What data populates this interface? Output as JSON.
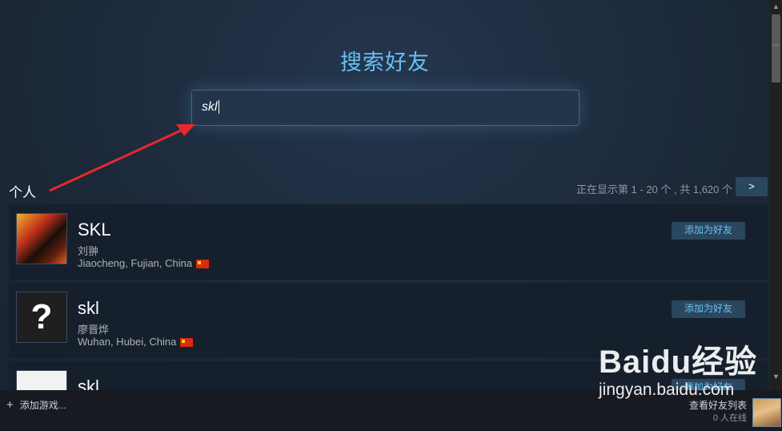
{
  "header": {
    "title": "搜索好友"
  },
  "search": {
    "value": "skl"
  },
  "results": {
    "section_label": "个人",
    "count_text": "正在显示第 1 - 20 个 , 共 1,620 个",
    "next_label": ">",
    "users": [
      {
        "name": "SKL",
        "alias": "刘翀",
        "location": "Jiaocheng, Fujian, China",
        "add_label": "添加为好友"
      },
      {
        "name": "skl",
        "alias": "廖晋烨",
        "location": "Wuhan, Hubei, China",
        "add_label": "添加为好友",
        "avatar_text": "?"
      },
      {
        "name": "skl",
        "add_label": "添加为好友"
      }
    ]
  },
  "bottom_bar": {
    "add_game_label": "添加游戏...",
    "friends_label": "查看好友列表",
    "online_label": "0 人在线"
  },
  "watermark": {
    "logo": "Baidu经验",
    "url": "jingyan.baidu.com"
  },
  "colors": {
    "accent": "#66c0f4",
    "background": "#1b2838",
    "button": "#2a475e",
    "annotation_arrow": "#e8282b"
  },
  "icons": [
    "flag-china-icon",
    "plus-icon",
    "scroll-up-icon",
    "scroll-down-icon"
  ]
}
